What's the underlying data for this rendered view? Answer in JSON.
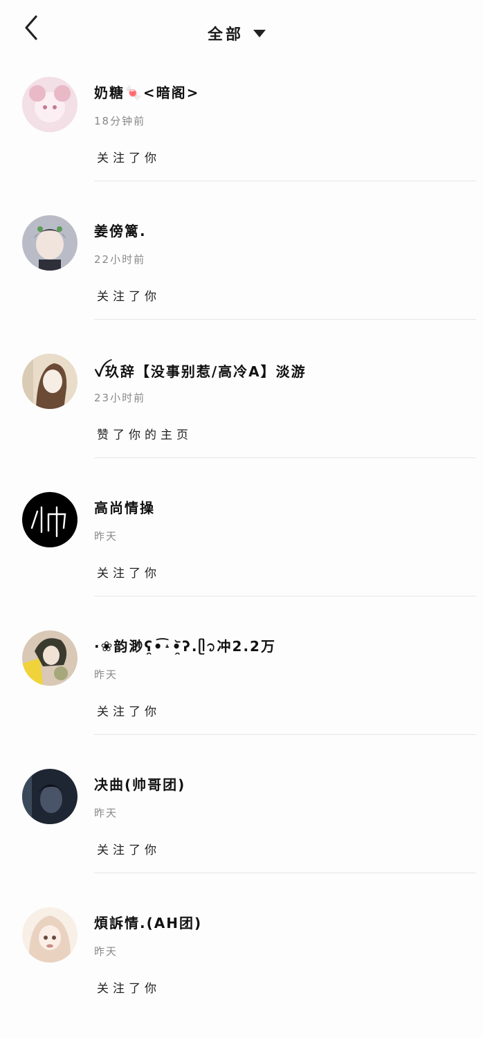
{
  "header": {
    "back_icon": "chevron-left-icon",
    "title": "全部",
    "dropdown_icon": "triangle-down-icon"
  },
  "notifications": [
    {
      "name": "奶糖🍬<暗阁>",
      "time": "18分钟前",
      "action": "关注了你",
      "avatar_colors": [
        "#f3dfe6",
        "#e9b9c8",
        "#ffffff"
      ]
    },
    {
      "name": "姜傍篱.",
      "time": "22小时前",
      "action": "关注了你",
      "avatar_colors": [
        "#b9bcc6",
        "#3b3b45",
        "#ffffff"
      ]
    },
    {
      "name": "ꪜ玖辞【没事别惹/高冷A】淡游",
      "time": "23小时前",
      "action": "赞了你的主页",
      "avatar_colors": [
        "#e9dcc9",
        "#6b4a36",
        "#f6eee4"
      ]
    },
    {
      "name": "高尚情操",
      "time": "昨天",
      "action": "关注了你",
      "avatar_colors": [
        "#000000",
        "#000000",
        "#ffffff"
      ]
    },
    {
      "name": "·❀韵渺ʕ̯•͡˔•̯᷅ʔ.ᥫ᭡冲2.2万",
      "time": "昨天",
      "action": "关注了你",
      "avatar_colors": [
        "#f0d33a",
        "#3a3a2f",
        "#d8c8b5"
      ]
    },
    {
      "name": "决曲(帅哥团)",
      "time": "昨天",
      "action": "关注了你",
      "avatar_colors": [
        "#1e2533",
        "#0b0f18",
        "#4a5468"
      ]
    },
    {
      "name": "煩訴情.(AH团)",
      "time": "昨天",
      "action": "关注了你",
      "avatar_colors": [
        "#e9d2c0",
        "#c98e83",
        "#f8efe7"
      ]
    }
  ]
}
